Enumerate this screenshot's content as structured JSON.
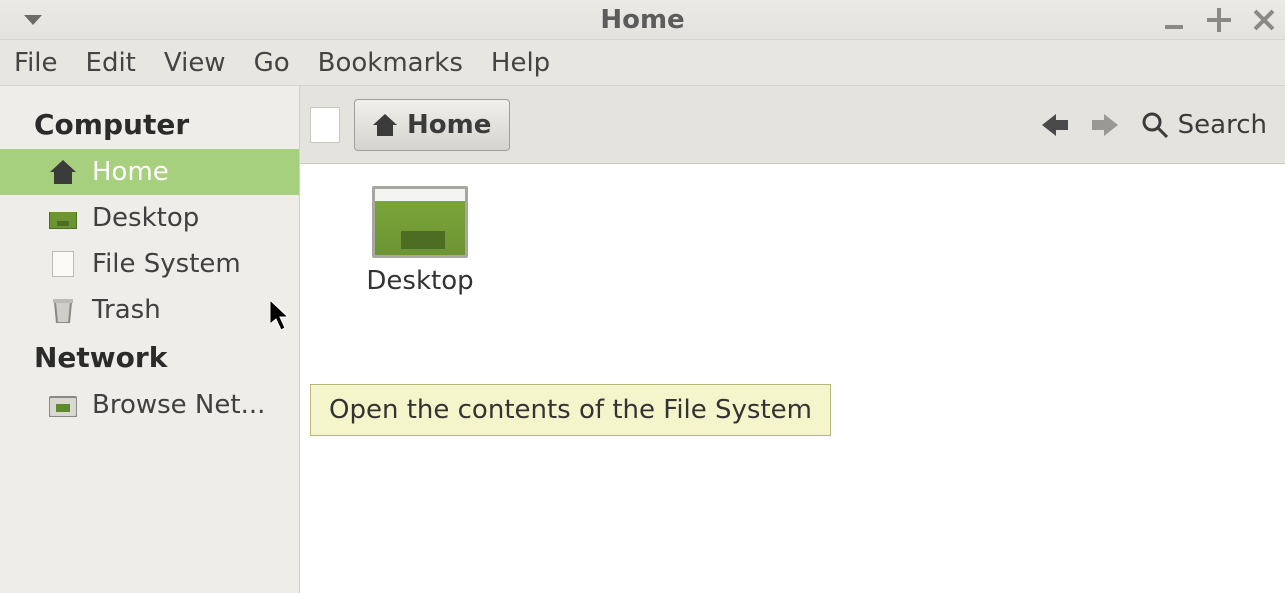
{
  "titlebar": {
    "title": "Home"
  },
  "menubar": {
    "items": [
      "File",
      "Edit",
      "View",
      "Go",
      "Bookmarks",
      "Help"
    ]
  },
  "sidebar": {
    "sections": [
      {
        "heading": "Computer",
        "items": [
          {
            "label": "Home",
            "icon": "home-icon",
            "selected": true
          },
          {
            "label": "Desktop",
            "icon": "desktop-icon",
            "selected": false
          },
          {
            "label": "File System",
            "icon": "document-icon",
            "selected": false
          },
          {
            "label": "Trash",
            "icon": "trash-icon",
            "selected": false
          }
        ]
      },
      {
        "heading": "Network",
        "items": [
          {
            "label": "Browse Net...",
            "icon": "network-icon",
            "selected": false
          }
        ]
      }
    ]
  },
  "toolbar": {
    "breadcrumb": "Home",
    "search_label": "Search"
  },
  "files": [
    {
      "label": "Desktop"
    }
  ],
  "tooltip": "Open the contents of the File System"
}
